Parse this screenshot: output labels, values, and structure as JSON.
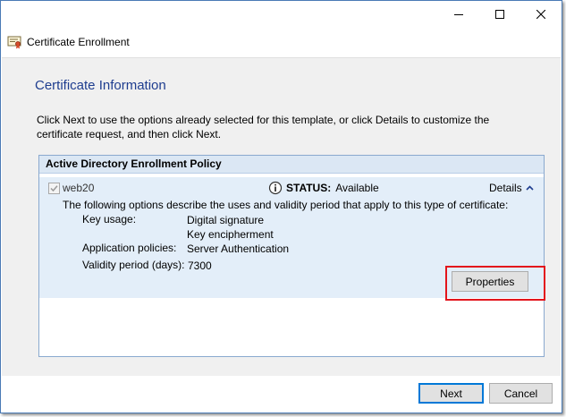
{
  "window": {
    "title": "Certificate Enrollment",
    "controls": {
      "minimize": "minimize-icon",
      "maximize": "maximize-icon",
      "close": "close-icon"
    }
  },
  "page": {
    "heading": "Certificate Information",
    "description": "Click Next to use the options already selected for this template, or click Details to customize the certificate request, and then click Next."
  },
  "policy": {
    "header": "Active Directory Enrollment Policy",
    "item": {
      "name": "web20",
      "checked": true,
      "status_label": "STATUS:",
      "status_value": "Available",
      "details_label": "Details",
      "options_description": "The following options describe the uses and validity period that apply to this type of certificate:",
      "key_usage_label": "Key usage:",
      "key_usage_values": [
        "Digital signature",
        "Key encipherment"
      ],
      "application_policies_label": "Application policies:",
      "application_policies_value": "Server Authentication",
      "validity_label": "Validity period (days):",
      "validity_value": "7300",
      "properties_button": "Properties"
    }
  },
  "footer": {
    "next_button": "Next",
    "cancel_button": "Cancel"
  },
  "colors": {
    "heading": "#1e3d8f",
    "panel_header": "#dbe7f4",
    "item_background": "#e3eef9",
    "highlight": "#e3141c",
    "primary_border": "#0078d7"
  }
}
